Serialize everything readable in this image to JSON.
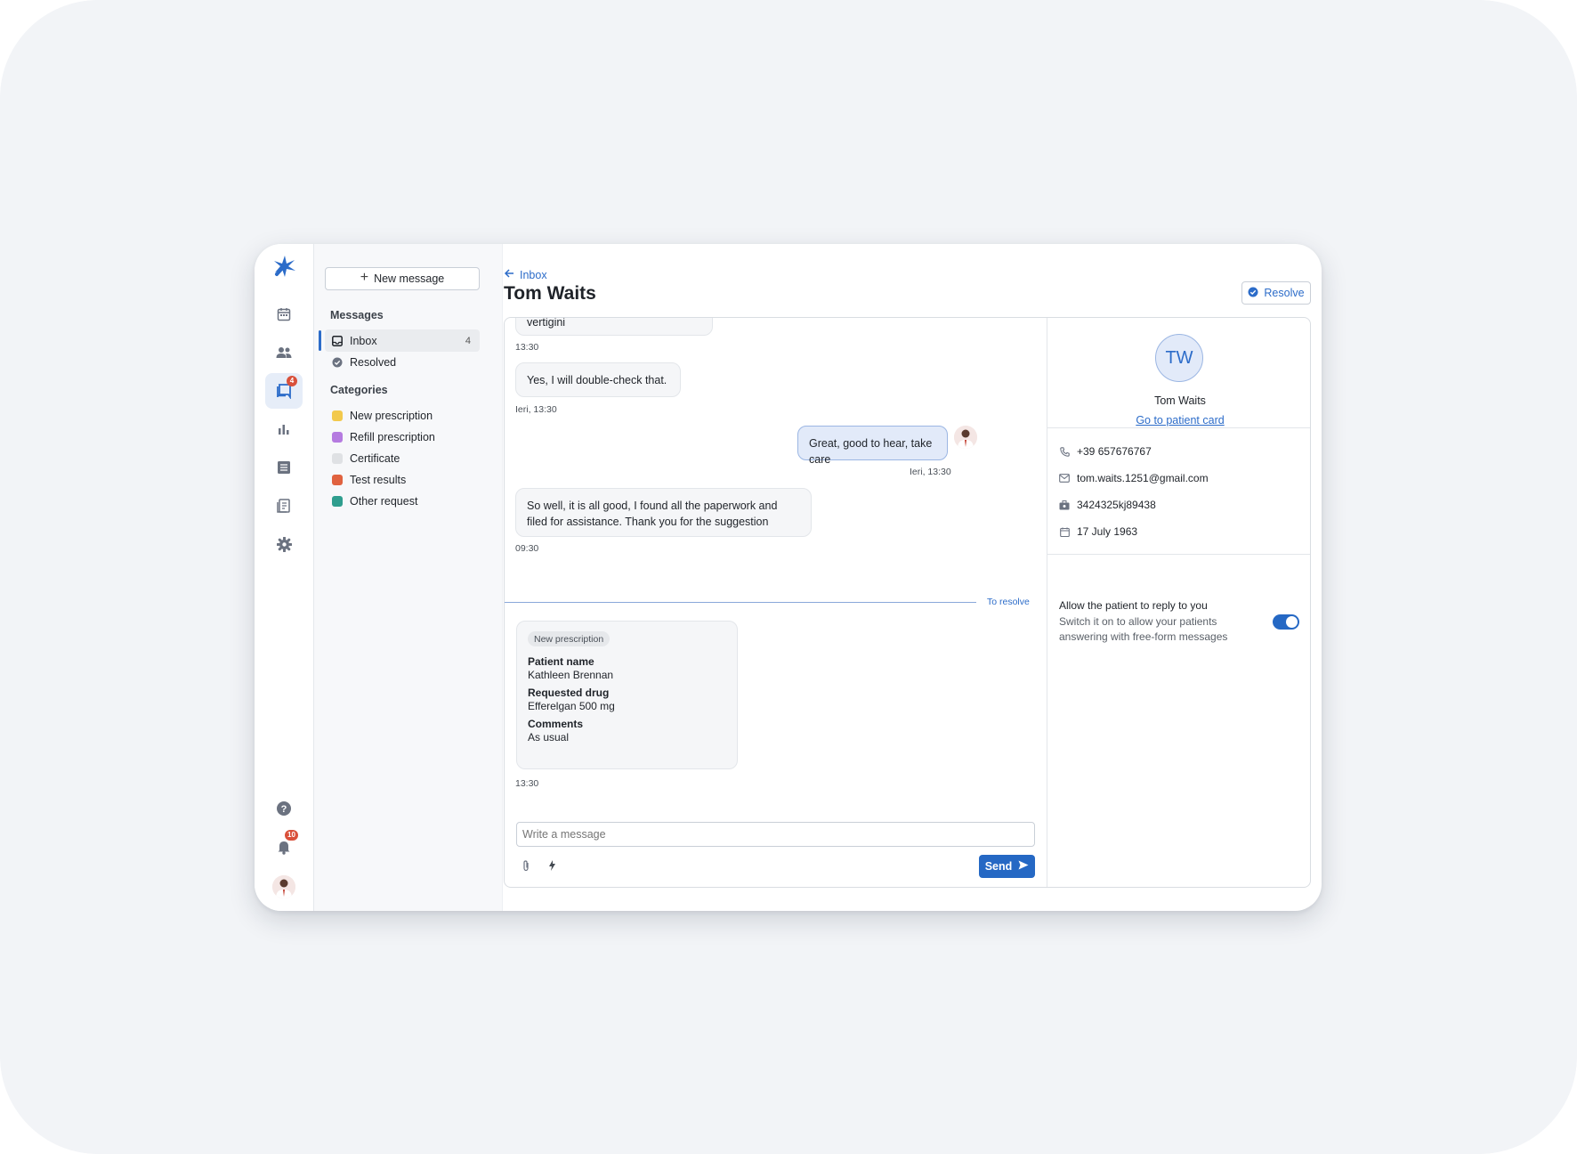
{
  "rail": {
    "items": [
      {
        "icon": "calendar-icon"
      },
      {
        "icon": "patients-icon"
      },
      {
        "icon": "messages-icon",
        "badge": "4",
        "active": true
      },
      {
        "icon": "stats-icon"
      },
      {
        "icon": "list-icon"
      },
      {
        "icon": "document-icon"
      },
      {
        "icon": "settings-icon"
      }
    ],
    "bottom": {
      "help_icon": "help-icon",
      "notifications_badge": "10",
      "avatar_icon": "doctor-avatar-icon"
    }
  },
  "nav": {
    "new_message_label": "New message",
    "messages_title": "Messages",
    "messages_items": [
      {
        "label": "Inbox",
        "count": "4",
        "icon": "inbox-icon"
      },
      {
        "label": "Resolved",
        "icon": "check-circle-icon"
      }
    ],
    "categories_title": "Categories",
    "categories": [
      {
        "label": "New prescription",
        "color": "#f2c94c"
      },
      {
        "label": "Refill prescription",
        "color": "#b57be0"
      },
      {
        "label": "Certificate",
        "color": "#dfe1e4"
      },
      {
        "label": "Test results",
        "color": "#e0623f"
      },
      {
        "label": "Other request",
        "color": "#2f9e8e"
      }
    ]
  },
  "header": {
    "breadcrumb": "Inbox",
    "title": "Tom Waits",
    "resolve_label": "Resolve"
  },
  "chat": {
    "messages": [
      {
        "text": "vertigini",
        "time": "13:30"
      },
      {
        "text": "Yes, I will double-check that.",
        "time": "Ieri, 13:30"
      },
      {
        "text": "Great, good to hear, take care",
        "time": "Ieri, 13:30",
        "mine": true
      },
      {
        "text": "So well, it is all good, I found all the paperwork and filed for assistance. Thank you for the suggestion",
        "time": "09:30"
      }
    ],
    "divider_label": "To resolve",
    "request_card": {
      "chip": "New prescription",
      "fields": [
        {
          "label": "Patient name",
          "value": "Kathleen Brennan"
        },
        {
          "label": "Requested drug",
          "value": "Efferelgan 500 mg"
        },
        {
          "label": "Comments",
          "value": "As usual"
        }
      ],
      "time": "13:30"
    },
    "composer_placeholder": "Write a message",
    "send_label": "Send"
  },
  "details": {
    "initials": "TW",
    "name": "Tom Waits",
    "patient_card_link": "Go to patient card",
    "phone": "+39 657676767",
    "email": "tom.waits.1251@gmail.com",
    "id_code": "3424325kj89438",
    "birthdate": "17 July 1963",
    "reply_title": "Allow the patient to reply to you",
    "reply_desc": "Switch it on to allow your patients answering with free-form messages",
    "reply_enabled": true
  },
  "colors": {
    "accent": "#2568c4",
    "badge": "#d9503a",
    "mine_bubble": "#e2eaf9"
  }
}
